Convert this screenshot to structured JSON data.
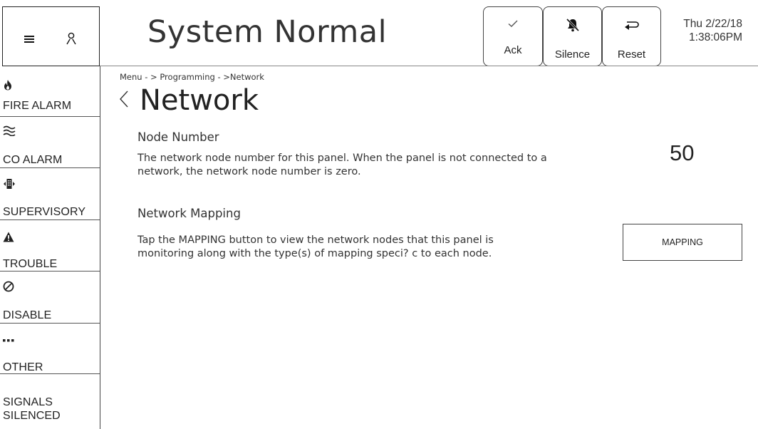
{
  "header": {
    "title": "System Normal",
    "buttons": {
      "ack": "Ack",
      "silence": "Silence",
      "reset": "Reset"
    },
    "date": "Thu 2/22/18",
    "time": "1:38:06PM"
  },
  "topleft": {
    "menu_icon": "hamburger-icon",
    "user_icon": "user-icon"
  },
  "sidebar": {
    "items": [
      {
        "label": "FIRE ALARM",
        "icon": "flame-icon"
      },
      {
        "label": "CO ALARM",
        "icon": "waves-icon"
      },
      {
        "label": "SUPERVISORY",
        "icon": "building-icon"
      },
      {
        "label": "TROUBLE",
        "icon": "warning-icon"
      },
      {
        "label": "DISABLE",
        "icon": "prohibited-icon"
      },
      {
        "label": "OTHER",
        "icon": "ellipsis-icon"
      },
      {
        "label_line1": "SIGNALS",
        "label_line2": "SILENCED"
      }
    ]
  },
  "main": {
    "breadcrumb": "Menu  - > Programming - >Network",
    "title": "Network",
    "node_number": {
      "title": "Node Number",
      "description_line1": "The network node number for this panel. When the panel is not connected to a",
      "description_line2": "network, the network node number is zero.",
      "value": "50"
    },
    "network_mapping": {
      "title": "Network Mapping",
      "description_line1": "Tap the MAPPING button to view the network nodes that this panel is",
      "description_line2": "monitoring along with the type(s) of mapping speci? c to each node.",
      "button_label": "MAPPING"
    }
  }
}
